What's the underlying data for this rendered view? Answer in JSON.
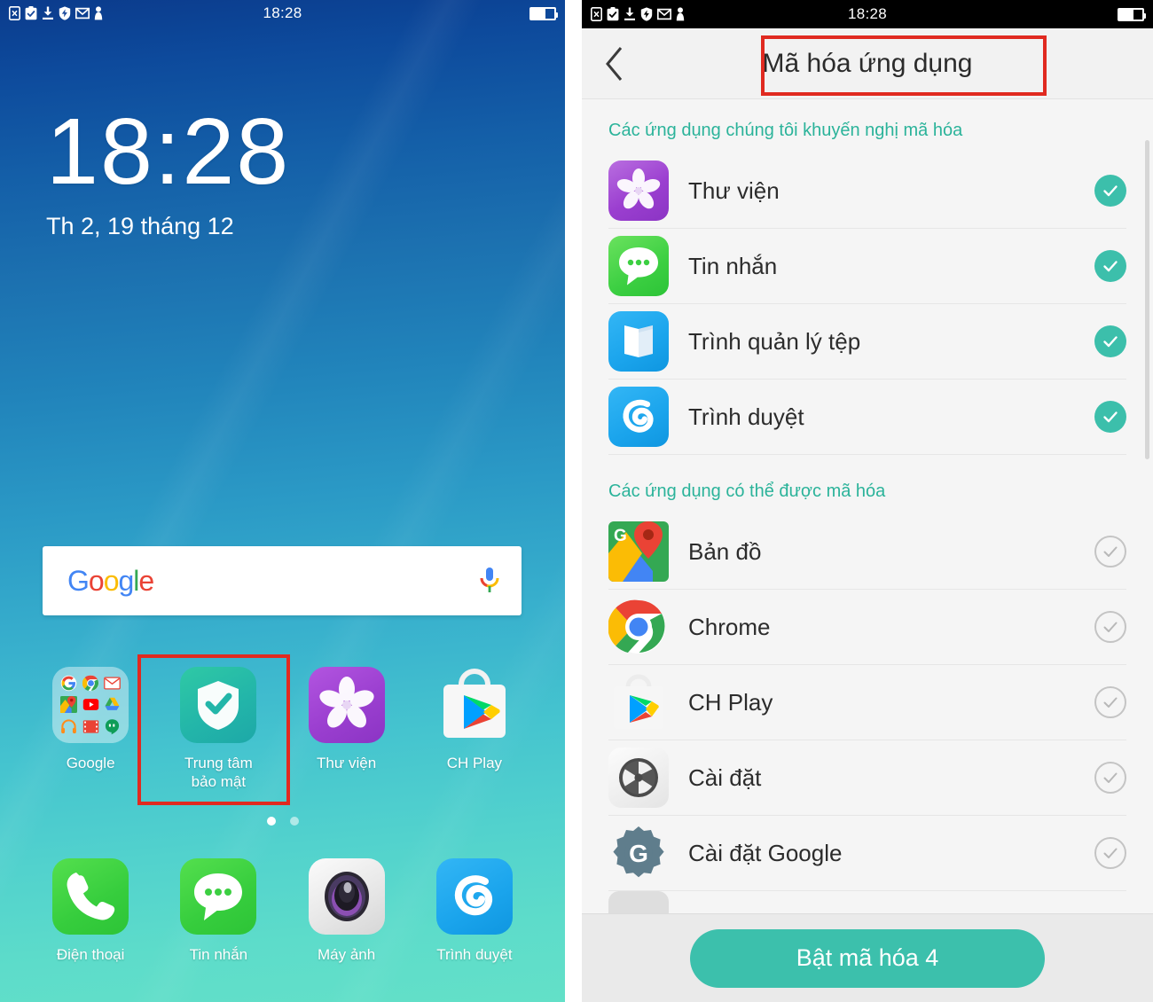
{
  "left_screen": {
    "statusbar": {
      "time": "18:28",
      "icons": [
        "sim-x-icon",
        "clipboard-check-icon",
        "download-icon",
        "shield-bolt-icon",
        "gmail-icon",
        "person-icon"
      ],
      "battery_level": 62
    },
    "lockclock": {
      "time": "18:28",
      "date": "Th 2, 19 tháng 12"
    },
    "search_widget": {
      "logo_text": "Google",
      "mic_icon": "microphone-icon"
    },
    "home_apps": [
      {
        "label": "Google",
        "icon": "google-folder-icon"
      },
      {
        "label": "Trung tâm bảo mật",
        "icon": "security-center-shield-icon",
        "highlighted": true
      },
      {
        "label": "Thư viện",
        "icon": "gallery-flower-icon"
      },
      {
        "label": "CH Play",
        "icon": "play-store-icon"
      }
    ],
    "page_dots": {
      "count": 2,
      "active_index": 0
    },
    "dock_apps": [
      {
        "label": "Điện thoại",
        "icon": "phone-icon"
      },
      {
        "label": "Tin nhắn",
        "icon": "messages-icon"
      },
      {
        "label": "Máy ảnh",
        "icon": "camera-icon"
      },
      {
        "label": "Trình duyệt",
        "icon": "browser-icon"
      }
    ]
  },
  "right_screen": {
    "statusbar": {
      "time": "18:28",
      "icons": [
        "sim-x-icon",
        "clipboard-check-icon",
        "download-icon",
        "shield-bolt-icon",
        "gmail-icon",
        "person-icon"
      ],
      "battery_level": 62
    },
    "appbar": {
      "back_icon": "chevron-left-icon",
      "title": "Mã hóa ứng dụng"
    },
    "sections": [
      {
        "header": "Các ứng dụng chúng tôi khuyến nghị mã hóa",
        "items": [
          {
            "label": "Thư viện",
            "icon": "gallery-flower-icon",
            "checked": true
          },
          {
            "label": "Tin nhắn",
            "icon": "messages-icon",
            "checked": true
          },
          {
            "label": "Trình quản lý tệp",
            "icon": "file-manager-icon",
            "checked": true
          },
          {
            "label": "Trình duyệt",
            "icon": "browser-icon",
            "checked": true
          }
        ]
      },
      {
        "header": "Các ứng dụng có thể được mã hóa",
        "items": [
          {
            "label": "Bản đồ",
            "icon": "google-maps-icon",
            "checked": false
          },
          {
            "label": "Chrome",
            "icon": "chrome-icon",
            "checked": false
          },
          {
            "label": "CH Play",
            "icon": "play-store-icon",
            "checked": false
          },
          {
            "label": "Cài đặt",
            "icon": "settings-gear-icon",
            "checked": false
          },
          {
            "label": "Cài đặt Google",
            "icon": "google-settings-gear-icon",
            "checked": false
          }
        ]
      }
    ],
    "footer": {
      "primary_button": "Bật mã hóa 4"
    }
  },
  "colors": {
    "accent_teal": "#3cc0ac",
    "section_header": "#2bb39a",
    "highlight_red": "#e02a20",
    "panel_bg": "#f5f5f5",
    "statusbar_black": "#000000"
  }
}
